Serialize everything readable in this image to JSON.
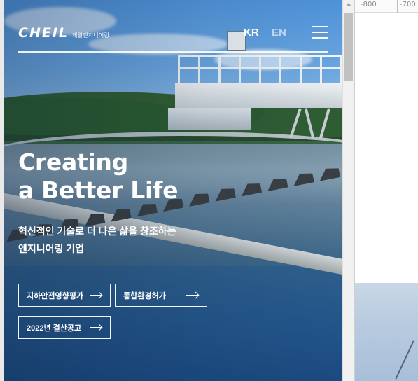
{
  "header": {
    "logo_text": "CHEIL",
    "logo_subtitle": "제일엔지니어링",
    "lang_kr": "KR",
    "lang_en": "EN",
    "menu_icon": "hamburger-menu-icon"
  },
  "hero": {
    "headline_line1": "Creating",
    "headline_line2": "a Better Life",
    "subcopy_line1": "혁신적인 기술로 더 나은 삶을 창조하는",
    "subcopy_line2": "엔지니어링 기업"
  },
  "buttons": [
    {
      "label": "지하안전영향평가",
      "icon": "arrow-right-icon"
    },
    {
      "label": "통합환경허가",
      "icon": "arrow-right-icon"
    },
    {
      "label": "2022년 결산공고",
      "icon": "arrow-right-icon"
    }
  ],
  "ruler": {
    "label_left": "-800",
    "label_right": "-700"
  },
  "colors": {
    "text": "#ffffff",
    "lang_inactive": "rgba(255,255,255,0.6)",
    "sky": "#4f92d8",
    "water": "#1f4d80"
  }
}
